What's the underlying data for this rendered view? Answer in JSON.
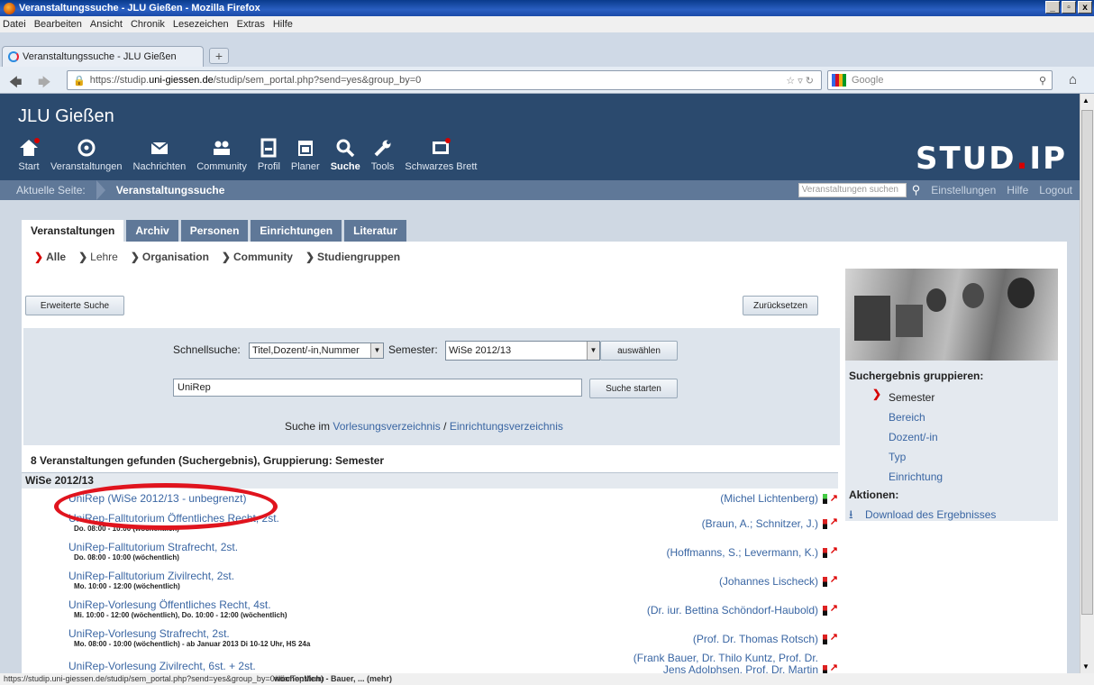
{
  "window": {
    "title": "Veranstaltungssuche - JLU Gießen - Mozilla Firefox",
    "controls": [
      "_",
      "▫",
      "x"
    ]
  },
  "menu": [
    "Datei",
    "Bearbeiten",
    "Ansicht",
    "Chronik",
    "Lesezeichen",
    "Extras",
    "Hilfe"
  ],
  "tab": {
    "label": "Veranstaltungssuche - JLU Gießen",
    "new_tab": "+"
  },
  "url": {
    "prefix": "https://studip.",
    "domain": "uni-giessen.de",
    "suffix": "/studip/sem_portal.php?send=yes&group_by=0"
  },
  "google": {
    "placeholder": "Google"
  },
  "site": {
    "title": "JLU Gießen",
    "logo_main": "STUD",
    "logo_dot": ".",
    "logo_end": "IP"
  },
  "nav": [
    {
      "label": "Start",
      "icon": "home-icon"
    },
    {
      "label": "Veranstaltungen",
      "icon": "courses-icon"
    },
    {
      "label": "Nachrichten",
      "icon": "mail-icon"
    },
    {
      "label": "Community",
      "icon": "community-icon"
    },
    {
      "label": "Profil",
      "icon": "profile-icon"
    },
    {
      "label": "Planer",
      "icon": "calendar-icon"
    },
    {
      "label": "Suche",
      "icon": "search-icon"
    },
    {
      "label": "Tools",
      "icon": "tools-icon"
    },
    {
      "label": "Schwarzes Brett",
      "icon": "board-icon"
    }
  ],
  "breadcrumb": {
    "label": "Aktuelle Seite:",
    "current": "Veranstaltungssuche"
  },
  "topright": {
    "search_placeholder": "Veranstaltungen suchen",
    "links": [
      "Einstellungen",
      "Hilfe",
      "Logout"
    ]
  },
  "tabs": [
    "Veranstaltungen",
    "Archiv",
    "Personen",
    "Einrichtungen",
    "Literatur"
  ],
  "subnav": [
    "Alle",
    "Lehre",
    "Organisation",
    "Community",
    "Studiengruppen"
  ],
  "buttons": {
    "extended": "Erweiterte Suche",
    "reset": "Zurücksetzen",
    "select": "auswählen",
    "start": "Suche starten"
  },
  "search": {
    "quick_label": "Schnellsuche:",
    "quick_value": "Titel,Dozent/-in,Nummer",
    "semester_label": "Semester:",
    "semester_value": "WiSe 2012/13",
    "query": "UniRep",
    "in_label": "Suche im",
    "link1": "Vorlesungsverzeichnis",
    "sep": "/",
    "link2": "Einrichtungsverzeichnis"
  },
  "results": {
    "heading": "8 Veranstaltungen gefunden (Suchergebnis), Gruppierung: Semester",
    "group": "WiSe 2012/13",
    "rows": [
      {
        "title": "UniRep (WiSe 2012/13 - unbegrenzt)",
        "time": "",
        "lecturer": "(Michel Lichtenberg)"
      },
      {
        "title": "UniRep-Falltutorium Öffentliches Recht, 2st.",
        "time": "Do. 08:00 - 10:00 (wöchentlich)",
        "lecturer": "(Braun, A.; Schnitzer, J.)"
      },
      {
        "title": "UniRep-Falltutorium Strafrecht, 2st.",
        "time": "Do. 08:00 - 10:00 (wöchentlich)",
        "lecturer": "(Hoffmanns, S.; Levermann, K.)"
      },
      {
        "title": "UniRep-Falltutorium Zivilrecht, 2st.",
        "time": "Mo. 10:00 - 12:00 (wöchentlich)",
        "lecturer": "(Johannes Lischeck)"
      },
      {
        "title": "UniRep-Vorlesung Öffentliches Recht, 4st.",
        "time": "Mi. 10:00 - 12:00 (wöchentlich), Do. 10:00 - 12:00 (wöchentlich)",
        "lecturer": "(Dr. iur. Bettina Schöndorf-Haubold)"
      },
      {
        "title": "UniRep-Vorlesung Strafrecht, 2st.",
        "time": "Mo. 08:00 - 10:00 (wöchentlich) - ab Januar 2013 Di 10-12 Uhr, HS 24a",
        "lecturer": "(Prof. Dr. Thomas Rotsch)"
      },
      {
        "title": "UniRep-Vorlesung Zivilrecht, 6st. + 2st.",
        "time": "",
        "lecturer": "(Frank Bauer, Dr. Thilo Kuntz, Prof. Dr. Jens Adolphsen, Prof. Dr. Martin"
      }
    ]
  },
  "sidebar": {
    "group_heading": "Suchergebnis gruppieren:",
    "group_items": [
      "Semester",
      "Bereich",
      "Dozent/-in",
      "Typ",
      "Einrichtung"
    ],
    "actions_heading": "Aktionen:",
    "download": "Download des Ergebnisses"
  },
  "status": {
    "url": "https://studip.uni-giessen.de/studip/sem_portal.php?send=yes&group_by=0#barTopMenu",
    "overlap": "wöchentlich) - Bauer, ... (mehr)"
  }
}
